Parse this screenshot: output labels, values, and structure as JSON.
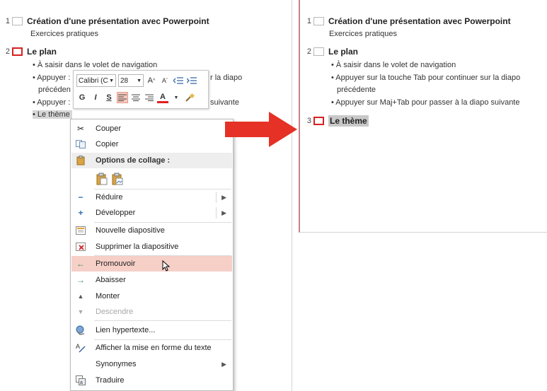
{
  "left": {
    "slides": [
      {
        "num": "1",
        "title": "Création d'une présentation avec Powerpoint",
        "subtitle": "Exercices pratiques"
      },
      {
        "num": "2",
        "title": "Le plan",
        "bullets": [
          "• À saisir dans le volet de navigation",
          "• Appuyer :",
          "r la diapo",
          "précéden",
          "• Appuyer :",
          "suivante",
          "• Le thème"
        ]
      }
    ]
  },
  "mini_toolbar": {
    "font": "Calibri (C",
    "size": "28",
    "grow": "A",
    "shrink": "A",
    "bold": "G",
    "italic": "I",
    "underline": "S",
    "color_a": "A"
  },
  "context_menu": {
    "items": [
      {
        "label": "Couper",
        "icon": "scissors-icon"
      },
      {
        "label": "Copier",
        "icon": "copy-icon"
      },
      {
        "label": "Options de collage :",
        "icon": "paste-icon"
      },
      {
        "label": "Réduire",
        "icon": "minus-icon",
        "submenu": true
      },
      {
        "label": "Développer",
        "icon": "plus-icon",
        "submenu": true
      },
      {
        "label": "Nouvelle diapositive",
        "icon": "new-slide-icon"
      },
      {
        "label": "Supprimer la diapositive",
        "icon": "delete-slide-icon"
      },
      {
        "label": "Promouvoir",
        "icon": "arrow-left-icon"
      },
      {
        "label": "Abaisser",
        "icon": "arrow-right-icon"
      },
      {
        "label": "Monter",
        "icon": "triangle-up-icon"
      },
      {
        "label": "Descendre",
        "icon": "triangle-down-icon",
        "disabled": true
      },
      {
        "label": "Lien hypertexte...",
        "icon": "hyperlink-icon"
      },
      {
        "label": "Afficher la mise en forme du texte",
        "icon": "text-format-icon"
      },
      {
        "label": "Synonymes",
        "icon": "",
        "submenu": true
      },
      {
        "label": "Traduire",
        "icon": "translate-icon"
      }
    ]
  },
  "right": {
    "slides": [
      {
        "num": "1",
        "title": "Création d'une présentation avec Powerpoint",
        "subtitle": "Exercices pratiques"
      },
      {
        "num": "2",
        "title": "Le plan",
        "bullets": [
          "• À saisir dans le volet de navigation",
          "• Appuyer sur la touche Tab pour continuer sur la diapo",
          "précédente",
          "• Appuyer sur Maj+Tab pour passer à la diapo suivante"
        ]
      },
      {
        "num": "3",
        "title": "Le thème"
      }
    ]
  },
  "colors": {
    "accent_red": "#e02020",
    "hover": "#f6cfc7",
    "selection": "#d6d6d6"
  }
}
